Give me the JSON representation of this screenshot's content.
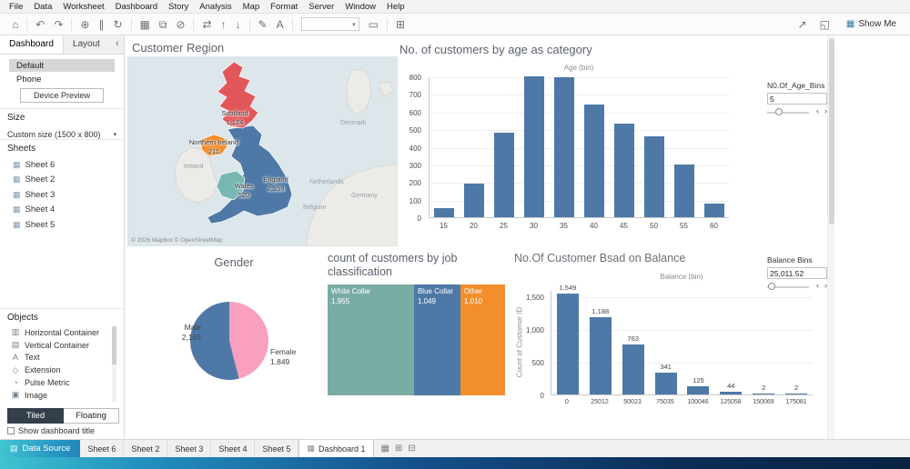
{
  "menu": {
    "items": [
      "File",
      "Data",
      "Worksheet",
      "Dashboard",
      "Story",
      "Analysis",
      "Map",
      "Format",
      "Server",
      "Window",
      "Help"
    ]
  },
  "toolbar": {
    "groups": [
      [
        {
          "name": "home-icon",
          "glyph": "⌂"
        }
      ],
      [
        {
          "name": "undo-icon",
          "glyph": "↶"
        },
        {
          "name": "redo-icon",
          "glyph": "↷"
        }
      ],
      [
        {
          "name": "new-data-source-icon",
          "glyph": "⊕"
        },
        {
          "name": "pause-updates-icon",
          "glyph": "∥"
        },
        {
          "name": "run-update-icon",
          "glyph": "↻"
        }
      ],
      [
        {
          "name": "new-worksheet-icon",
          "glyph": "▦"
        },
        {
          "name": "duplicate-icon",
          "glyph": "⧉"
        },
        {
          "name": "clear-sheet-icon",
          "glyph": "⊘"
        }
      ],
      [
        {
          "name": "swap-axes-icon",
          "glyph": "⇄"
        },
        {
          "name": "sort-ascending-icon",
          "glyph": "↑"
        },
        {
          "name": "sort-descending-icon",
          "glyph": "↓"
        }
      ],
      [
        {
          "name": "highlight-icon",
          "glyph": "✎"
        },
        {
          "name": "show-mark-labels-icon",
          "glyph": "A"
        }
      ],
      [
        {
          "name": "fit-dropdown",
          "type": "dropdown"
        },
        {
          "name": "fix-axes-icon",
          "glyph": "▭"
        }
      ],
      [
        {
          "name": "show-cards-icon",
          "glyph": "⊞"
        }
      ]
    ],
    "right_icons": [
      {
        "name": "share-icon",
        "glyph": "↗"
      },
      {
        "name": "presentation-mode-icon",
        "glyph": "◱"
      }
    ],
    "show_me_label": "Show Me",
    "show_me_icon": "▦"
  },
  "sidebar": {
    "tabs": {
      "dashboard": "Dashboard",
      "layout": "Layout"
    },
    "devices": {
      "default": "Default",
      "phone": "Phone"
    },
    "device_preview_label": "Device Preview",
    "size": {
      "label": "Size",
      "value": "Custom size (1500 x 800)"
    },
    "sheets": {
      "label": "Sheets",
      "items": [
        "Sheet 6",
        "Sheet 2",
        "Sheet 3",
        "Sheet 4",
        "Sheet 5"
      ]
    },
    "objects": {
      "label": "Objects",
      "items": [
        {
          "label": "Horizontal Container",
          "icon": "horizontal-container-icon",
          "glyph": "▥"
        },
        {
          "label": "Vertical Container",
          "icon": "vertical-container-icon",
          "glyph": "▤"
        },
        {
          "label": "Text",
          "icon": "text-object-icon",
          "glyph": "A"
        },
        {
          "label": "Extension",
          "icon": "extension-icon",
          "glyph": "◇"
        },
        {
          "label": "Pulse Metric",
          "icon": "pulse-metric-icon",
          "glyph": "◔"
        },
        {
          "label": "Image",
          "icon": "image-object-icon",
          "glyph": "▣"
        }
      ]
    },
    "layout_mode": {
      "tiled": "Tiled",
      "floating": "Floating"
    },
    "show_dashboard_title_label": "Show dashboard title"
  },
  "dashboard": {
    "map": {
      "attribution": "© 2026 Mapbox © OpenStreetMap",
      "context_labels": [
        "Ireland",
        "Denmark",
        "Netherlands",
        "Belgium",
        "Germany"
      ],
      "sea_color": "#dde6ea",
      "land_color": "#ecebe7"
    },
    "gender_colors": {
      "male": "#4e79a7",
      "female": "#f8a0bd"
    },
    "params": {
      "age": {
        "label": "N0.Of_Age_Bins",
        "value": "5"
      },
      "balance": {
        "label": "Balance Bins",
        "value": "25,011.52"
      }
    }
  },
  "bottom_bar": {
    "data_source_label": "Data Source",
    "data_source_icon": "▤",
    "sheet_tabs": [
      "Sheet 6",
      "Sheet 2",
      "Sheet 3",
      "Sheet 4",
      "Sheet 5"
    ],
    "dashboard_tab": "Dashboard 1",
    "dashboard_tab_icon": "▦",
    "new_icons": [
      {
        "name": "new-worksheet-tab-icon",
        "glyph": "▦"
      },
      {
        "name": "new-dashboard-tab-icon",
        "glyph": "⊞"
      },
      {
        "name": "new-story-tab-icon",
        "glyph": "⊟"
      }
    ]
  },
  "chart_data": [
    {
      "type": "map",
      "title": "Customer Region",
      "regions": [
        {
          "name": "Scotland",
          "value": 1124,
          "color": "#e15759"
        },
        {
          "name": "Northern Ireland",
          "value": 211,
          "color": "#f28e2b"
        },
        {
          "name": "Wales",
          "value": 520,
          "color": "#76b7b2"
        },
        {
          "name": "England",
          "value": 2159,
          "color": "#4e79a7"
        }
      ]
    },
    {
      "type": "bar",
      "title": "No. of customers by age as category",
      "xlabel": "Age (bin)",
      "ylabel": "",
      "categories": [
        15,
        20,
        25,
        30,
        35,
        40,
        45,
        50,
        55,
        60
      ],
      "values": [
        50,
        190,
        480,
        800,
        795,
        640,
        530,
        460,
        300,
        75
      ],
      "yticks": [
        0,
        100,
        200,
        300,
        400,
        500,
        600,
        700,
        800
      ],
      "ylim": [
        0,
        800
      ],
      "bar_color": "#4e79a7"
    },
    {
      "type": "pie",
      "title": "Gender",
      "categories": [
        "Male",
        "Female"
      ],
      "values": [
        2165,
        1849
      ],
      "colors": [
        "#4e79a7",
        "#f8a0bd"
      ]
    },
    {
      "type": "treemap",
      "title": "count of customers by job classification",
      "categories": [
        "White Collar",
        "Blue Collar",
        "Other"
      ],
      "values": [
        1955,
        1049,
        1010
      ],
      "colors": [
        "#79aca4",
        "#4e79a7",
        "#f28e2b"
      ]
    },
    {
      "type": "bar",
      "title": "No.Of Customer Bsad on Balance",
      "xlabel": "Balance (bin)",
      "ylabel": "Count of Customer ID",
      "categories": [
        0,
        25012,
        50023,
        75035,
        100046,
        125058,
        150069,
        175081
      ],
      "values": [
        1549,
        1188,
        763,
        341,
        125,
        44,
        2,
        2
      ],
      "yticks": [
        0,
        500,
        1000,
        1500
      ],
      "ylim": [
        0,
        1600
      ],
      "bar_color": "#4e79a7"
    }
  ]
}
